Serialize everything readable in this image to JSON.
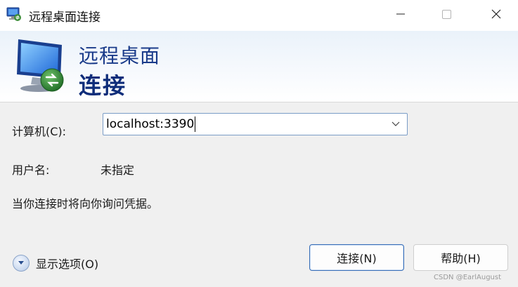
{
  "window": {
    "title": "远程桌面连接"
  },
  "banner": {
    "line1": "远程桌面",
    "line2": "连接"
  },
  "form": {
    "computer_label": "计算机(C):",
    "computer_value": "localhost:3390",
    "username_label": "用户名:",
    "username_value": "未指定",
    "credentials_note": "当你连接时将向你询问凭据。"
  },
  "footer": {
    "show_options_label": "显示选项(O)",
    "connect_label": "连接(N)",
    "help_label": "帮助(H)",
    "watermark": "CSDN @EarlAugust"
  },
  "icons": {
    "title_icon": "remote-desktop-icon",
    "banner_icon": "remote-desktop-monitor-icon",
    "options_icon": "chevron-down-icon",
    "combo_arrow": "chevron-down-icon"
  },
  "colors": {
    "banner_text": "#1a3b8a",
    "accent_border": "#3a6fb7",
    "window_bg": "#f0f0f0"
  }
}
